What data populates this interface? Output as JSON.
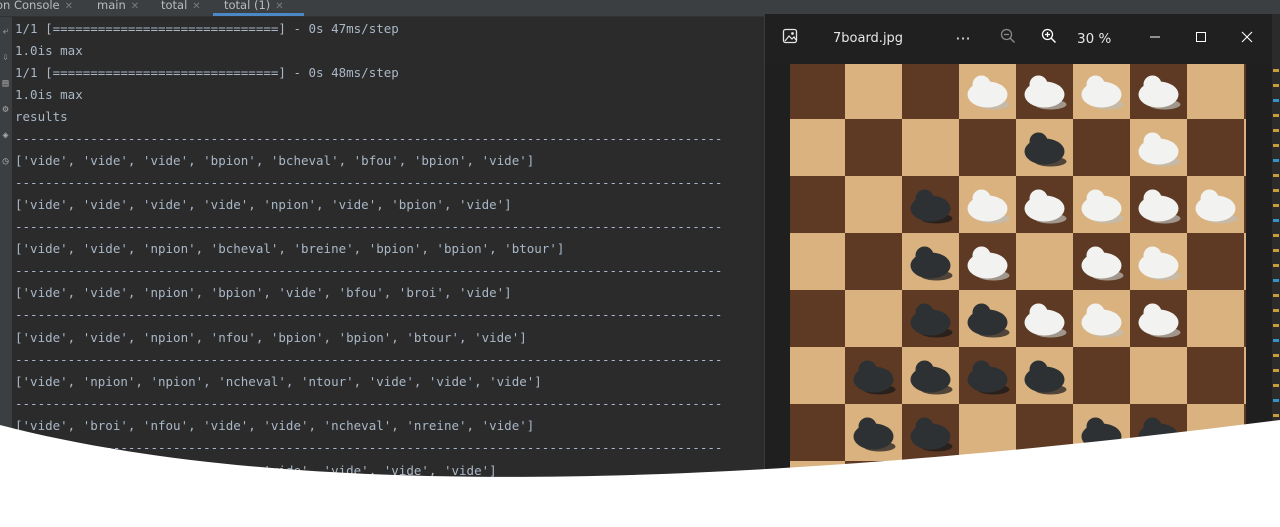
{
  "tabs": [
    {
      "label": "on Console",
      "active": false
    },
    {
      "label": "main",
      "active": false
    },
    {
      "label": "total",
      "active": false
    },
    {
      "label": "total (1)",
      "active": true
    }
  ],
  "console": {
    "lines": [
      {
        "kind": "text",
        "text": "1/1 [==============================] - 0s 47ms/step"
      },
      {
        "kind": "text",
        "text": "1.0is max"
      },
      {
        "kind": "text",
        "text": "1/1 [==============================] - 0s 48ms/step"
      },
      {
        "kind": "text",
        "text": "1.0is max"
      },
      {
        "kind": "text",
        "text": "results"
      },
      {
        "kind": "sep",
        "text": "----------------------------------------------------------------------------------------------"
      },
      {
        "kind": "text",
        "text": "['vide', 'vide', 'vide', 'bpion', 'bcheval', 'bfou', 'bpion', 'vide']"
      },
      {
        "kind": "sep",
        "text": "----------------------------------------------------------------------------------------------"
      },
      {
        "kind": "text",
        "text": "['vide', 'vide', 'vide', 'vide', 'npion', 'vide', 'bpion', 'vide']"
      },
      {
        "kind": "sep",
        "text": "----------------------------------------------------------------------------------------------"
      },
      {
        "kind": "text",
        "text": "['vide', 'vide', 'npion', 'bcheval', 'breine', 'bpion', 'bpion', 'btour']"
      },
      {
        "kind": "sep",
        "text": "----------------------------------------------------------------------------------------------"
      },
      {
        "kind": "text",
        "text": "['vide', 'vide', 'npion', 'bpion', 'vide', 'bfou', 'broi', 'vide']"
      },
      {
        "kind": "sep",
        "text": "----------------------------------------------------------------------------------------------"
      },
      {
        "kind": "text",
        "text": "['vide', 'vide', 'npion', 'nfou', 'bpion', 'bpion', 'btour', 'vide']"
      },
      {
        "kind": "sep",
        "text": "----------------------------------------------------------------------------------------------"
      },
      {
        "kind": "text",
        "text": "['vide', 'npion', 'npion', 'ncheval', 'ntour', 'vide', 'vide', 'vide']"
      },
      {
        "kind": "sep",
        "text": "----------------------------------------------------------------------------------------------"
      },
      {
        "kind": "text",
        "text": "['vide', 'broi', 'nfou', 'vide', 'vide', 'ncheval', 'nreine', 'vide']"
      },
      {
        "kind": "sep",
        "text": "----------------------------------------------------------------------------------------------"
      },
      {
        "kind": "text",
        "text": "['vide', 'vide', 'vide', 'vide', 'vide', 'vide', 'vide', 'vide']"
      }
    ]
  },
  "photos": {
    "filename": "7board.jpg",
    "zoom": "30 %",
    "more_label": "···",
    "icons": {
      "gallery": "image-gallery-icon",
      "zoom_out": "zoom-out-icon",
      "zoom_in": "zoom-in-icon",
      "minimize": "minimize-icon",
      "maximize": "maximize-icon",
      "close": "close-icon"
    }
  },
  "board": {
    "ranks": [
      [
        "",
        "",
        "",
        "w",
        "w",
        "w",
        "w",
        ""
      ],
      [
        "",
        "",
        "",
        "",
        "b",
        "",
        "w",
        ""
      ],
      [
        "",
        "",
        "b",
        "w",
        "w",
        "w",
        "w",
        "w"
      ],
      [
        "",
        "",
        "b",
        "w",
        "",
        "w",
        "w",
        ""
      ],
      [
        "",
        "",
        "b",
        "b",
        "w",
        "w",
        "w",
        ""
      ],
      [
        "",
        "b",
        "b",
        "b",
        "b",
        "",
        "",
        ""
      ],
      [
        "",
        "b",
        "b",
        "",
        "",
        "b",
        "b",
        ""
      ]
    ]
  }
}
